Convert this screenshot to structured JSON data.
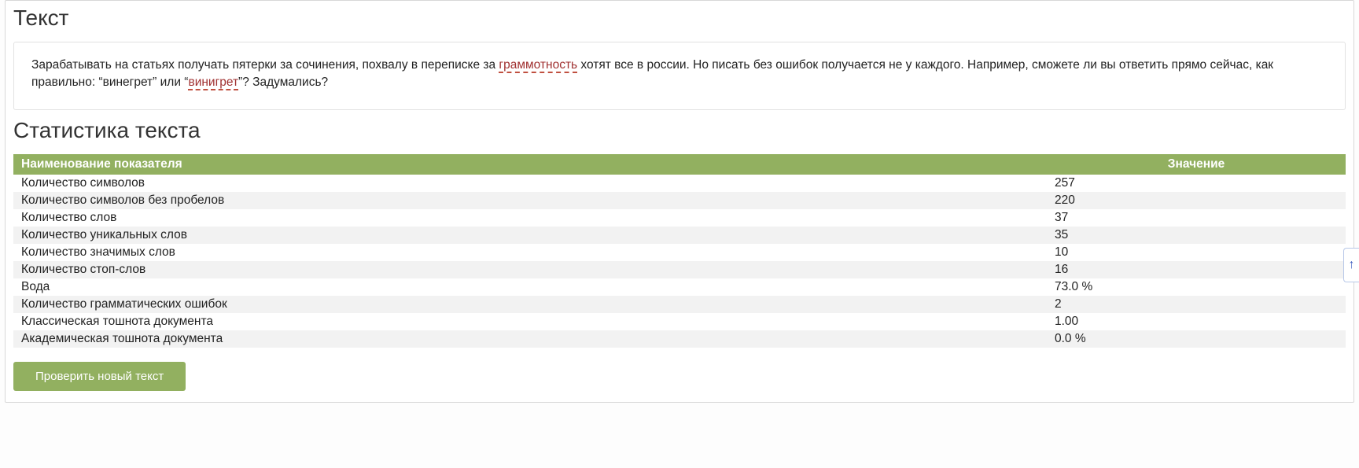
{
  "headings": {
    "text": "Текст",
    "stats": "Статистика текста"
  },
  "sample_text": {
    "pre1": "Зарабатывать на статьях получать пятерки за сочинения, похвалу в переписке за ",
    "err1": "граммотность",
    "mid1": " хотят все в россии. Но писать без ошибок получается не у каждого. Например, сможете ли вы ответить прямо сейчас, как правильно: “винегрет” или “",
    "err2": "винигрет",
    "post1": "”? Задумались?"
  },
  "table": {
    "col_name": "Наименование показателя",
    "col_value": "Значение",
    "rows": [
      {
        "name": "Количество символов",
        "value": "257"
      },
      {
        "name": "Количество символов без пробелов",
        "value": "220"
      },
      {
        "name": "Количество слов",
        "value": "37"
      },
      {
        "name": "Количество уникальных слов",
        "value": "35"
      },
      {
        "name": "Количество значимых слов",
        "value": "10"
      },
      {
        "name": "Количество стоп-слов",
        "value": "16"
      },
      {
        "name": "Вода",
        "value": "73.0 %"
      },
      {
        "name": "Количество грамматических ошибок",
        "value": "2"
      },
      {
        "name": "Классическая тошнота документа",
        "value": "1.00"
      },
      {
        "name": "Академическая тошнота документа",
        "value": "0.0 %"
      }
    ]
  },
  "buttons": {
    "check_new": "Проверить новый текст"
  },
  "side_tab_glyph": "↑"
}
